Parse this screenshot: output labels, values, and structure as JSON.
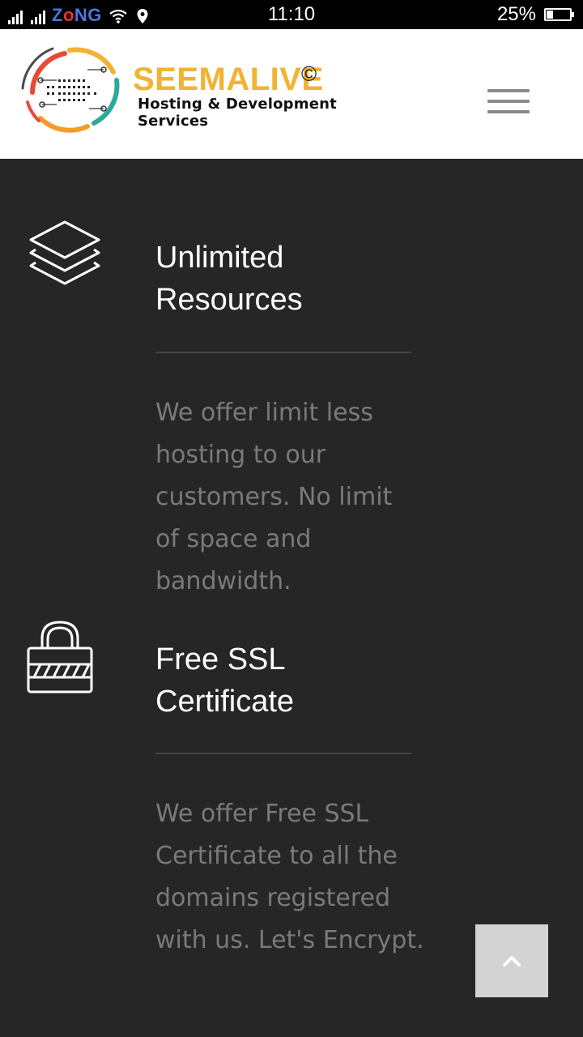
{
  "status_bar": {
    "carrier_prefix": "Z",
    "carrier_o": "o",
    "carrier_rest": "NG",
    "time": "11:10",
    "battery_percent_label": "25%",
    "battery_level": 0.25
  },
  "header": {
    "brand_name": "SEEMALIVE",
    "brand_copyright": "©",
    "brand_tagline": "Hosting & Development Services"
  },
  "features": [
    {
      "icon": "layers-icon",
      "title_line1": "Unlimited",
      "title_line2": "Resources",
      "description_lines": [
        "We offer limit less",
        "hosting to our",
        "customers. No limit",
        "of space and",
        "bandwidth."
      ]
    },
    {
      "icon": "padlock-icon",
      "title_line1": "Free SSL",
      "title_line2": "Certificate",
      "description_lines": [
        "We offer Free SSL",
        "Certificate to all the",
        "domains registered",
        "with us. Let's Encrypt."
      ]
    }
  ],
  "colors": {
    "background": "#262626",
    "brand_accent": "#f1b332",
    "title_text": "#ffffff",
    "body_text": "#7a7a7a",
    "back_to_top": "#d3d3d3"
  }
}
